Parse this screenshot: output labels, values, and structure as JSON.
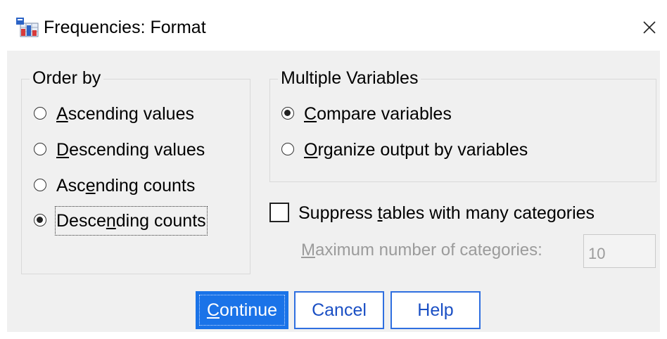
{
  "window": {
    "title": "Frequencies: Format",
    "app_icon": "spss-frequencies-icon",
    "close_icon": "close-icon"
  },
  "order_by": {
    "legend": "Order by",
    "options": [
      {
        "pre": "",
        "key": "A",
        "post": "scending values",
        "selected": false
      },
      {
        "pre": "",
        "key": "D",
        "post": "escending values",
        "selected": false
      },
      {
        "pre": "Asc",
        "key": "e",
        "post": "nding counts",
        "selected": false
      },
      {
        "pre": "Desce",
        "key": "n",
        "post": "ding counts",
        "selected": true
      }
    ]
  },
  "multiple_variables": {
    "legend": "Multiple Variables",
    "options": [
      {
        "pre": "",
        "key": "C",
        "post": "ompare variables",
        "selected": true
      },
      {
        "pre": "",
        "key": "O",
        "post": "rganize output by variables",
        "selected": false
      }
    ]
  },
  "suppress": {
    "pre": "Suppress ",
    "key": "t",
    "post": "ables with many categories",
    "checked": false
  },
  "max_categories": {
    "key": "M",
    "post": "aximum number of categories:",
    "value": "10"
  },
  "buttons": {
    "continue": {
      "key": "C",
      "post": "ontinue"
    },
    "cancel": "Cancel",
    "help": "Help"
  },
  "colors": {
    "primary_button": "#1a73e8",
    "secondary_button_border": "#2f6fe0",
    "dialog_background": "#f0f0f0"
  }
}
